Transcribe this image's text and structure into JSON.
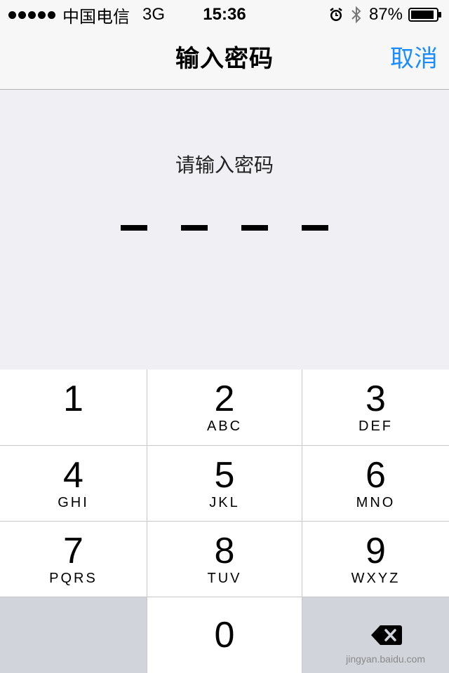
{
  "status_bar": {
    "carrier": "中国电信",
    "network": "3G",
    "time": "15:36",
    "battery_percent": "87%"
  },
  "nav": {
    "title": "输入密码",
    "cancel_label": "取消",
    "accent_color": "#1a8cff"
  },
  "passcode": {
    "prompt": "请输入密码",
    "entered_digits": 0,
    "total_digits": 4
  },
  "keypad": {
    "keys": [
      {
        "digit": "1",
        "letters": ""
      },
      {
        "digit": "2",
        "letters": "ABC"
      },
      {
        "digit": "3",
        "letters": "DEF"
      },
      {
        "digit": "4",
        "letters": "GHI"
      },
      {
        "digit": "5",
        "letters": "JKL"
      },
      {
        "digit": "6",
        "letters": "MNO"
      },
      {
        "digit": "7",
        "letters": "PQRS"
      },
      {
        "digit": "8",
        "letters": "TUV"
      },
      {
        "digit": "9",
        "letters": "WXYZ"
      },
      {
        "digit": "0",
        "letters": ""
      }
    ],
    "delete_icon": "backspace-icon"
  },
  "watermark": {
    "text": "jingyan.baidu.com"
  }
}
